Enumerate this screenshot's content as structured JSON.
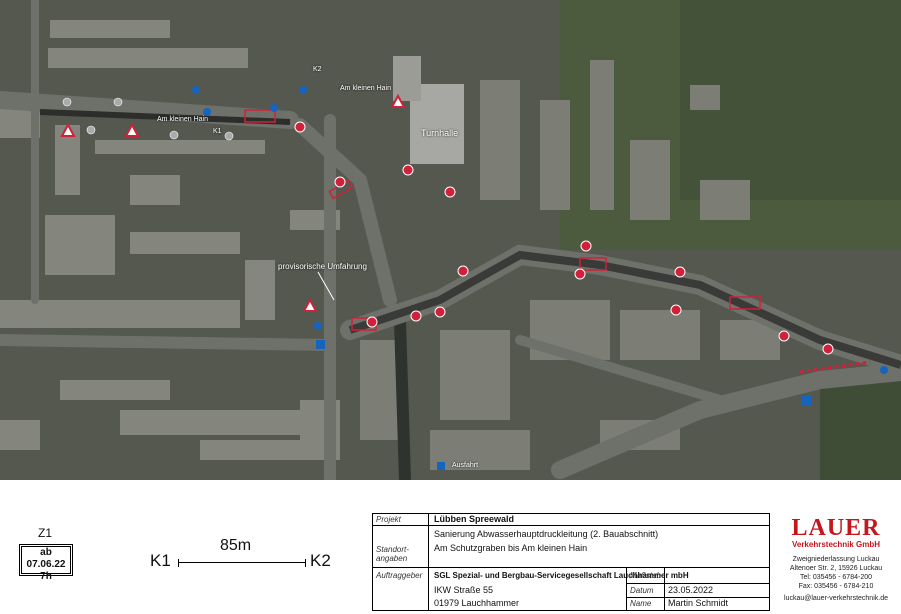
{
  "map": {
    "labels": {
      "turnhalle": "Turnhalle",
      "umfahrung": "provisorische Umfahrung",
      "kleiner_hain": "Am kleinen Hain",
      "am_kleinen_hain2": "Am kleinen Hain",
      "k1": "K1",
      "k2": "K2",
      "bottom_label": "Ausfahrt"
    }
  },
  "titleblock": {
    "z1": "Z1",
    "date_box_line1": "ab 07.06.22",
    "date_box_line2": "7h",
    "scale_k1": "K1",
    "scale_k2": "K2",
    "scale_length": "85m",
    "projekt_label": "Projekt",
    "projekt_value": "Lübben Spreewald",
    "descr_line1": "Sanierung Abwasserhauptdruckleitung (2. Bauabschnitt)",
    "standort_label_1": "Standort-",
    "standort_label_2": "angaben",
    "standort_value": "Am Schutzgraben bis Am kleinen Hain",
    "auftraggeber_label": "Auftraggeber",
    "auftraggeber_line1": "SGL Spezial- und Bergbau-Servicegesellschaft Lauchhammer mbH",
    "auftraggeber_line2": "IKW Straße 55",
    "auftraggeber_line3": "01979 Lauchhammer",
    "massstab_label": "Maßstab",
    "massstab_value": "",
    "datum_label": "Datum",
    "datum_value": "23.05.2022",
    "name_label": "Name",
    "name_value": "Martin Schmidt"
  },
  "logo": {
    "name": "LAUER",
    "subtitle": "Verkehrstechnik GmbH",
    "addr1": "Zweigniederlassung Luckau",
    "addr2": "Altenoer Str. 2, 15926 Luckau",
    "tel": "Tel: 035456 - 6784-200",
    "fax": "Fax: 035456 - 6784-210",
    "mail": "luckau@lauer-verkehrstechnik.de"
  },
  "colors": {
    "sign_red": "#d0203a",
    "sign_blue": "#1565c0",
    "brand_red": "#c4161c"
  }
}
